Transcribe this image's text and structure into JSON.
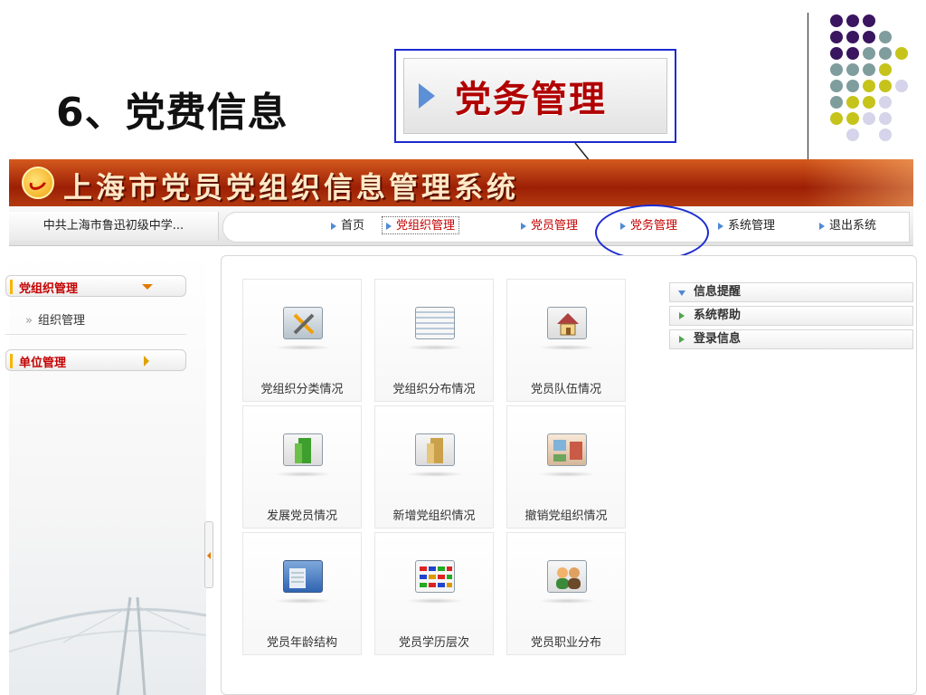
{
  "slide": {
    "title": "6、党费信息",
    "callout_text": "党务管理"
  },
  "app": {
    "title": "上海市党员党组织信息管理系统",
    "org_name": "中共上海市鲁迅初级中学..."
  },
  "nav": {
    "items": [
      {
        "label": "首页"
      },
      {
        "label": "党组织管理"
      },
      {
        "label": "党员管理"
      },
      {
        "label": "党务管理"
      },
      {
        "label": "系统管理"
      },
      {
        "label": "退出系统"
      }
    ]
  },
  "sidebar": {
    "group1": "党组织管理",
    "sub1": "组织管理",
    "sub_mark": "»",
    "group2": "单位管理"
  },
  "tiles": [
    {
      "label": "党组织分类情况",
      "icon": "tools-icon"
    },
    {
      "label": "党组织分布情况",
      "icon": "document-list-icon"
    },
    {
      "label": "党员队伍情况",
      "icon": "house-icon"
    },
    {
      "label": "发展党员情况",
      "icon": "green-folder-icon"
    },
    {
      "label": "新增党组织情况",
      "icon": "yellow-folder-icon"
    },
    {
      "label": "撤销党组织情况",
      "icon": "room-icon"
    },
    {
      "label": "党员年龄结构",
      "icon": "blue-screen-icon"
    },
    {
      "label": "党员学历层次",
      "icon": "flags-icon"
    },
    {
      "label": "党员职业分布",
      "icon": "people-icon"
    }
  ],
  "info_panel": {
    "items": [
      {
        "label": "信息提醒"
      },
      {
        "label": "系统帮助"
      },
      {
        "label": "登录信息"
      }
    ]
  },
  "colors": {
    "accent_blue": "#1c2bd1",
    "header_red": "#9c1f05",
    "active_red": "#c40000",
    "dot_purple": "#3a1560",
    "dot_teal": "#7f9d9d",
    "dot_olive": "#c6c31b",
    "dot_lavender": "#d5d4ea"
  }
}
